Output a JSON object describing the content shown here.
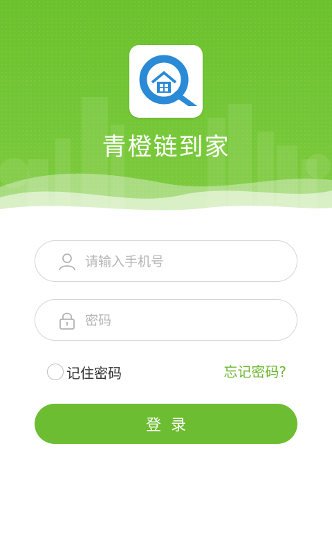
{
  "app": {
    "title": "青橙链到家"
  },
  "login_form": {
    "phone": {
      "placeholder": "请输入手机号",
      "value": ""
    },
    "password": {
      "placeholder": "密码",
      "value": ""
    },
    "remember_label": "记住密码",
    "remember_checked": false,
    "forgot_label": "忘记密码?",
    "submit_label": "登录"
  },
  "icons": {
    "logo": "q-house-logo-icon",
    "phone_field": "user-icon",
    "password_field": "lock-icon"
  },
  "colors": {
    "header_green": "#73c635",
    "accent_green": "#6cbd31",
    "logo_blue": "#2a8ad6",
    "link_green": "#6bb62f"
  }
}
